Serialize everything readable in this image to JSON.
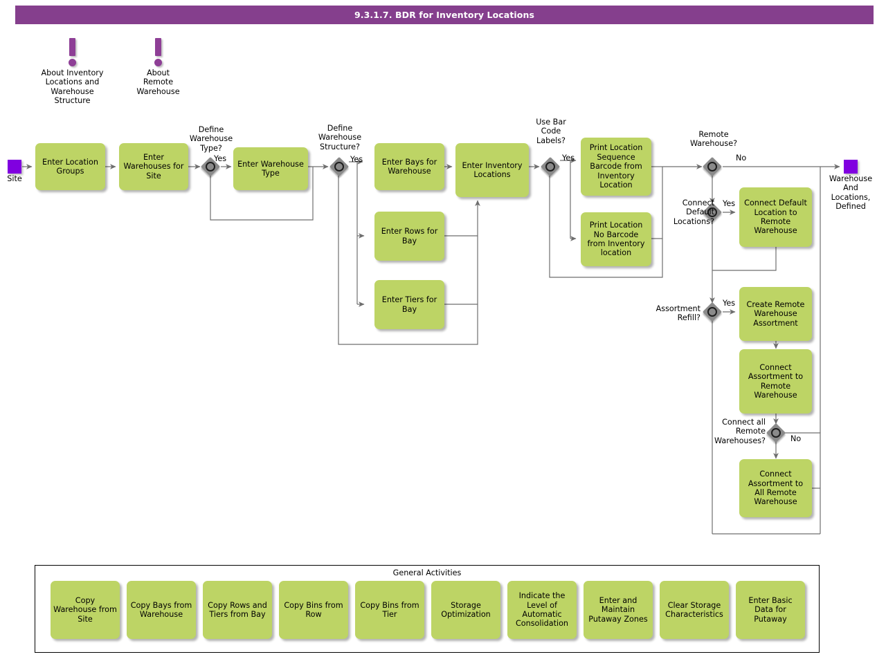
{
  "header": {
    "title": "9.3.1.7. BDR for Inventory Locations",
    "bar_color": "#853f8d"
  },
  "theme": {
    "task_fill": "#bdd465",
    "event_fill": "#8000e0",
    "gateway_fill": "#8a8a8a",
    "annotation_color": "#8e3f96",
    "connector_color": "#666666"
  },
  "annotations": [
    {
      "id": "about-inventory-locations",
      "icon": "exclamation-icon",
      "text": "About Inventory\nLocations and\nWarehouse\nStructure"
    },
    {
      "id": "about-remote-warehouse",
      "icon": "exclamation-icon",
      "text": "About\nRemote\nWarehouse"
    }
  ],
  "events": [
    {
      "id": "start-site",
      "type": "start",
      "label": "Site"
    },
    {
      "id": "end-warehouse-defined",
      "type": "end",
      "label": "Warehouse\nAnd\nLocations,\nDefined"
    }
  ],
  "tasks": [
    {
      "id": "enter-location-groups",
      "label": "Enter Location\nGroups"
    },
    {
      "id": "enter-warehouses-for-site",
      "label": "Enter\nWarehouses for\nSite"
    },
    {
      "id": "enter-warehouse-type",
      "label": "Enter\nWarehouse Type"
    },
    {
      "id": "enter-bays-for-warehouse",
      "label": "Enter Bays for\nWarehouse"
    },
    {
      "id": "enter-rows-for-bay",
      "label": "Enter Rows for\nBay"
    },
    {
      "id": "enter-tiers-for-bay",
      "label": "Enter Tiers for\nBay"
    },
    {
      "id": "enter-inventory-locations",
      "label": "Enter Inventory\nLocations"
    },
    {
      "id": "print-location-sequence-barcode",
      "label": "Print Location\nSequence\nBarcode from\nInventory\nLocation"
    },
    {
      "id": "print-location-no-barcode",
      "label": "Print Location No\nBarcode from\nInventory\nlocation"
    },
    {
      "id": "connect-default-location-to-remote-warehouse",
      "label": "Connect Default\nLocation to\nRemote\nWarehouse"
    },
    {
      "id": "create-remote-warehouse-assortment",
      "label": "Create Remote\nWarehouse\nAssortment"
    },
    {
      "id": "connect-assortment-to-remote-warehouse",
      "label": "Connect\nAssortment to\nRemote\nWarehouse"
    },
    {
      "id": "connect-assortment-to-all-remote-warehouse",
      "label": "Connect\nAssortment to\nAll Remote\nWarehouse"
    }
  ],
  "gateways": [
    {
      "id": "define-warehouse-type",
      "label": "Define\nWarehouse\nType?"
    },
    {
      "id": "define-warehouse-structure",
      "label": "Define\nWarehouse\nStructure?"
    },
    {
      "id": "use-bar-code-labels",
      "label": "Use Bar\nCode\nLabels?"
    },
    {
      "id": "remote-warehouse",
      "label": "Remote\nWarehouse?"
    },
    {
      "id": "connect-default-locations",
      "label": "Connect\nDefault\nLocations?"
    },
    {
      "id": "assortment-refill",
      "label": "Assortment\nRefill?"
    },
    {
      "id": "connect-all-remote-warehouses",
      "label": "Connect all\nRemote\nWarehouses?"
    }
  ],
  "flow_labels": {
    "yes_warehouse_type": "Yes",
    "yes_warehouse_structure": "Yes",
    "yes_bar_code": "Yes",
    "no_remote_warehouse": "No",
    "yes_connect_default": "Yes",
    "yes_assortment_refill": "Yes",
    "no_connect_all_remote": "No"
  },
  "general_activities": {
    "title": "General Activities",
    "items": [
      {
        "id": "copy-warehouse-from-site",
        "label": "Copy Warehouse\nfrom Site"
      },
      {
        "id": "copy-bays-from-warehouse",
        "label": "Copy Bays from\nWarehouse"
      },
      {
        "id": "copy-rows-and-tiers-from-bay",
        "label": "Copy Rows and\nTiers from Bay"
      },
      {
        "id": "copy-bins-from-row",
        "label": "Copy Bins from\nRow"
      },
      {
        "id": "copy-bins-from-tier",
        "label": "Copy Bins from\nTier"
      },
      {
        "id": "storage-optimization",
        "label": "Storage\nOptimization"
      },
      {
        "id": "indicate-level-of-automatic-consolidation",
        "label": "Indicate the\nLevel of\nAutomatic\nConsolidation"
      },
      {
        "id": "enter-and-maintain-putaway-zones",
        "label": "Enter and\nMaintain\nPutaway Zones"
      },
      {
        "id": "clear-storage-characteristics",
        "label": "Clear\nStorage\nCharacteristics"
      },
      {
        "id": "enter-basic-data-for-putaway",
        "label": "Enter Basic Data\nfor Putaway"
      }
    ]
  }
}
